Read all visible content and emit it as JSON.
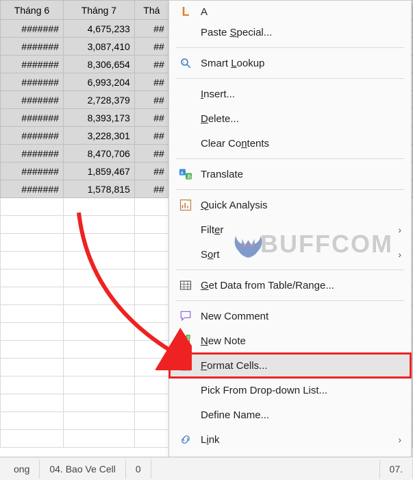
{
  "headers": [
    "Tháng 6",
    "Tháng 7",
    "Thá"
  ],
  "rows": [
    [
      "#######",
      "4,675,233",
      "##"
    ],
    [
      "#######",
      "3,087,410",
      "##"
    ],
    [
      "#######",
      "8,306,654",
      "##"
    ],
    [
      "#######",
      "6,993,204",
      "##"
    ],
    [
      "#######",
      "2,728,379",
      "##"
    ],
    [
      "#######",
      "8,393,173",
      "##"
    ],
    [
      "#######",
      "3,228,301",
      "##"
    ],
    [
      "#######",
      "8,470,706",
      "##"
    ],
    [
      "#######",
      "1,859,467",
      "##"
    ],
    [
      "#######",
      "1,578,815",
      "##"
    ]
  ],
  "menu": {
    "top_remnant": "A",
    "paste_special": "Paste Special...",
    "smart_lookup": "Smart Lookup",
    "insert": "Insert...",
    "delete": "Delete...",
    "clear_contents": "Clear Contents",
    "translate": "Translate",
    "quick_analysis": "Quick Analysis",
    "filter": "Filter",
    "sort": "Sort",
    "get_data": "Get Data from Table/Range...",
    "new_comment": "New Comment",
    "new_note": "New Note",
    "format_cells": "Format Cells...",
    "pick_list": "Pick From Drop-down List...",
    "define_name": "Define Name...",
    "link": "Link"
  },
  "underline": {
    "paste_special": "S",
    "smart_lookup": "L",
    "insert": "I",
    "delete": "D",
    "clear_contents": "n",
    "translate": "",
    "quick_analysis": "Q",
    "filter": "e",
    "sort": "o",
    "get_data": "G",
    "new_comment": "M",
    "new_note": "N",
    "format_cells": "F",
    "pick_list": "K",
    "define_name": "A",
    "link": "i"
  },
  "tabs": [
    "ong",
    "04. Bao Ve Cell",
    "0",
    "07. "
  ],
  "watermark": "BUFFCOM"
}
